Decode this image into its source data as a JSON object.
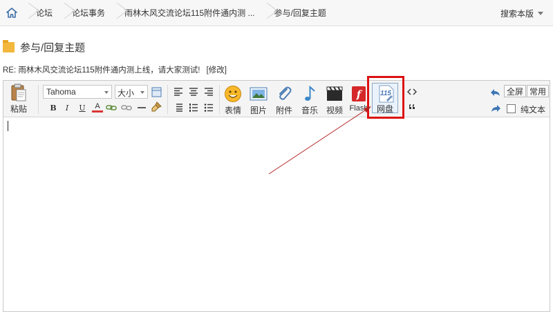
{
  "breadcrumb": {
    "items": [
      "论坛",
      "论坛事务",
      "雨林木风交流论坛115附件通内测 ...",
      "参与/回复主题"
    ],
    "search_label": "搜索本版"
  },
  "page": {
    "title": "参与/回复主题",
    "re_subject": "RE: 雨林木风交流论坛115附件通内测上线，请大家测试!",
    "edit_link": "[修改]"
  },
  "toolbar": {
    "paste_label": "粘贴",
    "font_value": "Tahoma",
    "size_value": "大小",
    "fmt": {
      "bold": "B",
      "italic": "I",
      "underline": "U",
      "color": "A"
    },
    "emoji_label": "表情",
    "image_label": "图片",
    "attach_label": "附件",
    "music_label": "音乐",
    "video_label": "视频",
    "flash_label": "Flash",
    "netdisk_label": "网盘",
    "netdisk_badge": "115",
    "fullscreen_label": "全屏",
    "common_label": "常用",
    "plaintext_label": "纯文本"
  },
  "colors": {
    "highlight": "#dd1111",
    "arrow": "#b22222",
    "folder": "#f3b73d"
  }
}
